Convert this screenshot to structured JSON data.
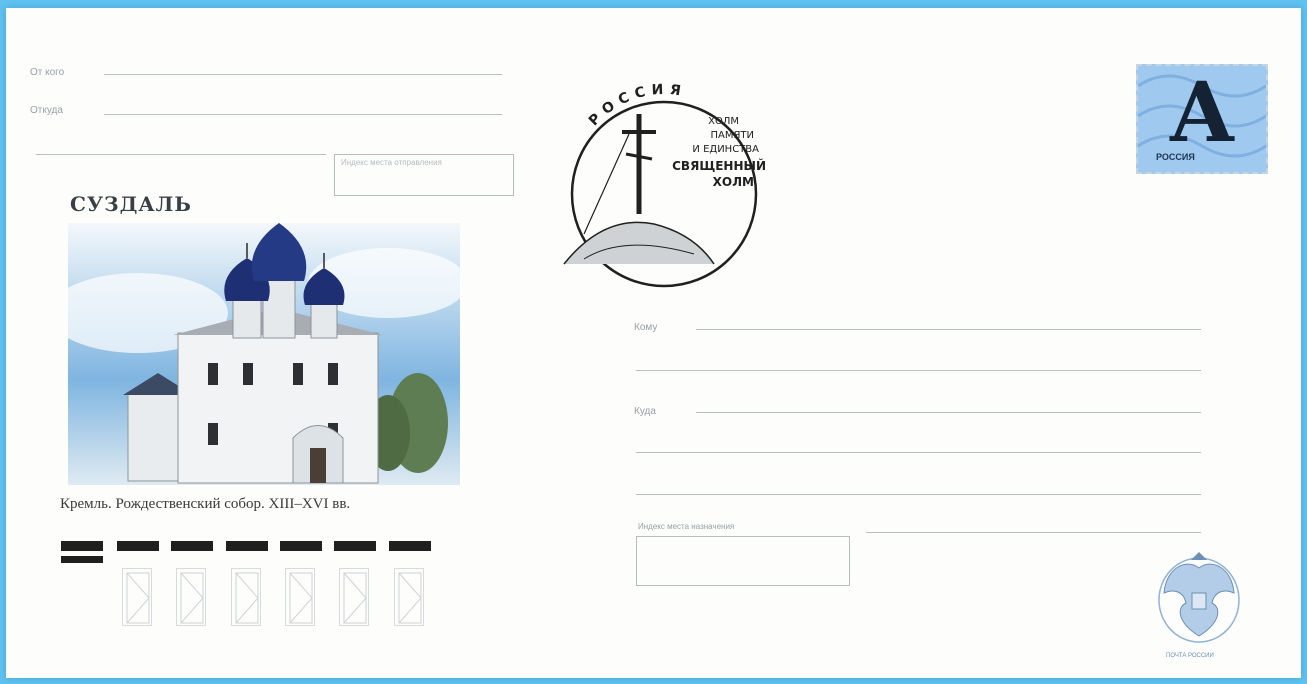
{
  "envelope": {
    "sender": {
      "from_label": "От кого",
      "from_where_label": "Откуда",
      "index_label": "Индекс места отправления"
    },
    "illustration": {
      "city_title": "СУЗДАЛЬ",
      "caption": "Кремль. Рождественский собор. XIII–XVI вв."
    },
    "postmark": {
      "country": "РОССИЯ",
      "line1": "ХОЛМ",
      "line2": "ПАМЯТИ",
      "line3": "И ЕДИНСТВА",
      "line4": "СВЯЩЕННЫЙ",
      "line5": "ХОЛМ"
    },
    "stamp": {
      "letter": "А",
      "country": "РОССИЯ"
    },
    "recipient": {
      "to_label": "Кому",
      "address_label": "Куда",
      "index_label": "Индекс места назначения"
    },
    "emblem_caption": "ПОЧТА РОССИИ"
  },
  "colors": {
    "background": "#5ec1ef",
    "stamp": "#9fc9ef",
    "ink": "#1f1f1f"
  }
}
